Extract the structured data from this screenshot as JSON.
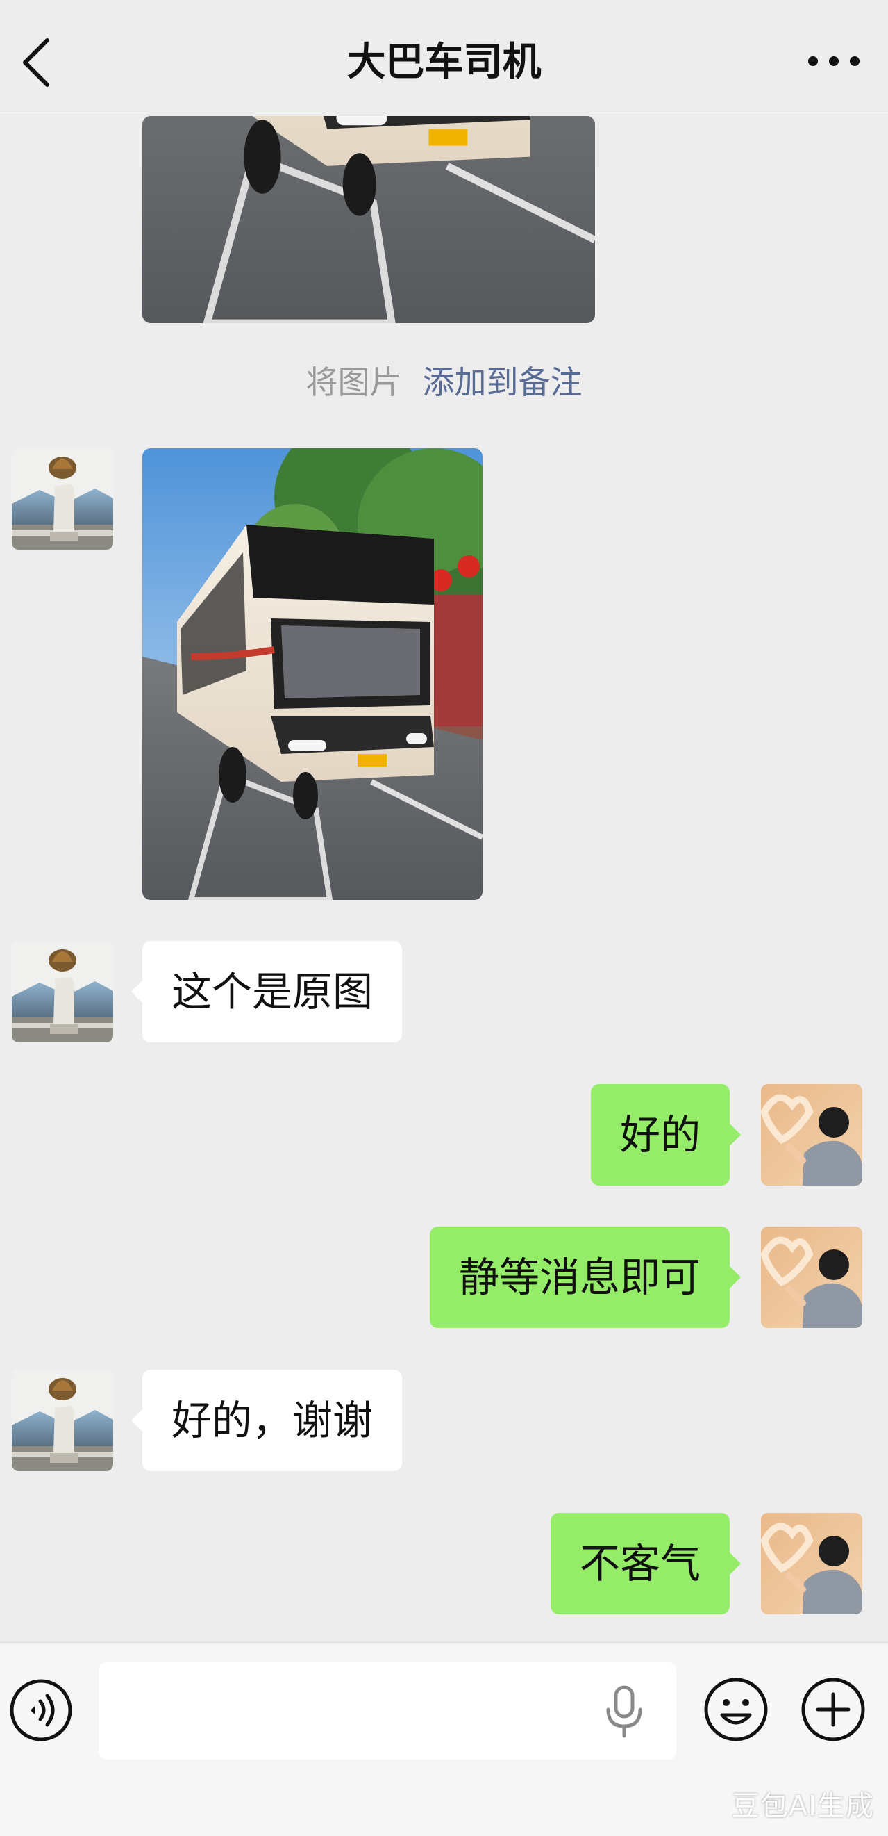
{
  "header": {
    "title": "大巴车司机",
    "back_icon": "chevron-left-icon",
    "more_icon": "more-dots-icon"
  },
  "messages": [
    {
      "sender": "contact",
      "type": "image",
      "content": "bus photo (partially scrolled)"
    },
    {
      "type": "hint",
      "text": "将图片",
      "link": "添加到备注"
    },
    {
      "sender": "contact",
      "type": "image",
      "content": "bus photo"
    },
    {
      "sender": "contact",
      "type": "text",
      "text": "这个是原图"
    },
    {
      "sender": "me",
      "type": "text",
      "text": "好的"
    },
    {
      "sender": "me",
      "type": "text",
      "text": "静等消息即可"
    },
    {
      "sender": "contact",
      "type": "text",
      "text": "好的，谢谢"
    },
    {
      "sender": "me",
      "type": "text",
      "text": "不客气"
    }
  ],
  "input_bar": {
    "voice_icon": "voice-icon",
    "message_placeholder": "",
    "mic_icon": "microphone-icon",
    "emoji_icon": "emoji-icon",
    "plus_icon": "plus-icon"
  },
  "watermark": "豆包AI生成",
  "colors": {
    "background": "#ededed",
    "incoming_bubble": "#ffffff",
    "outgoing_bubble": "#95ec69",
    "link": "#576b95",
    "hint_text": "#999999"
  }
}
